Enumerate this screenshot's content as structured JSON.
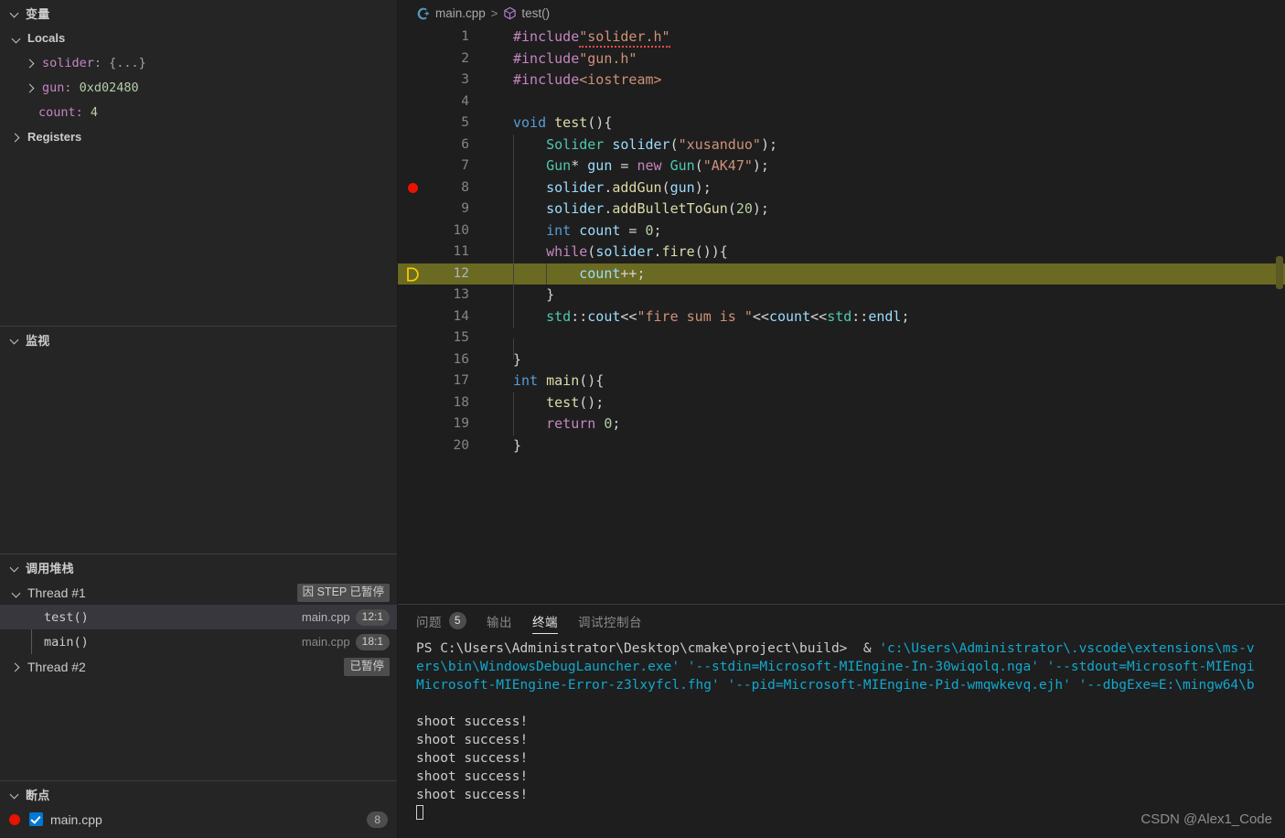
{
  "sidebar": {
    "variables": {
      "title": "变量",
      "locals_label": "Locals",
      "registers_label": "Registers",
      "locals": [
        {
          "name": "solider:",
          "value": "{...}",
          "value_kind": "object",
          "expandable": true
        },
        {
          "name": "gun:",
          "value": "0xd02480",
          "value_kind": "number",
          "expandable": true
        },
        {
          "name": "count:",
          "value": "4",
          "value_kind": "number",
          "expandable": false
        }
      ]
    },
    "watch": {
      "title": "监视",
      "items": []
    },
    "callstack": {
      "title": "调用堆栈",
      "threads": [
        {
          "name": "Thread #1",
          "status": "因 STEP 已暂停",
          "expanded": true,
          "frames": [
            {
              "func": "test()",
              "file": "main.cpp",
              "pos": "12:1",
              "selected": true
            },
            {
              "func": "main()",
              "file": "main.cpp",
              "pos": "18:1",
              "selected": false
            }
          ]
        },
        {
          "name": "Thread #2",
          "status": "已暂停",
          "expanded": false,
          "frames": []
        }
      ]
    },
    "breakpoints": {
      "title": "断点",
      "items": [
        {
          "file": "main.cpp",
          "line": "8",
          "enabled": true
        }
      ]
    }
  },
  "editor": {
    "breadcrumb": {
      "file": "main.cpp",
      "separator": ">",
      "symbol": "test()"
    },
    "lines": [
      {
        "n": "1",
        "tokens": [
          {
            "t": "#include",
            "c": "t-pre"
          },
          {
            "t": "\"solider.h\"",
            "c": "t-str squiggle"
          }
        ]
      },
      {
        "n": "2",
        "tokens": [
          {
            "t": "#include",
            "c": "t-pre"
          },
          {
            "t": "\"gun.h\"",
            "c": "t-str"
          }
        ]
      },
      {
        "n": "3",
        "tokens": [
          {
            "t": "#include",
            "c": "t-pre"
          },
          {
            "t": "<iostream>",
            "c": "t-str"
          }
        ]
      },
      {
        "n": "4",
        "tokens": []
      },
      {
        "n": "5",
        "tokens": [
          {
            "t": "void ",
            "c": "t-kw"
          },
          {
            "t": "test",
            "c": "t-fn"
          },
          {
            "t": "(){",
            "c": "t-plain"
          }
        ]
      },
      {
        "n": "6",
        "indent": 1,
        "tokens": [
          {
            "t": "    ",
            "c": "t-plain"
          },
          {
            "t": "Solider",
            "c": "t-type"
          },
          {
            "t": " solider",
            "c": "t-var"
          },
          {
            "t": "(",
            "c": "t-plain"
          },
          {
            "t": "\"xusanduo\"",
            "c": "t-str"
          },
          {
            "t": ");",
            "c": "t-plain"
          }
        ]
      },
      {
        "n": "7",
        "indent": 1,
        "tokens": [
          {
            "t": "    ",
            "c": "t-plain"
          },
          {
            "t": "Gun",
            "c": "t-type"
          },
          {
            "t": "* ",
            "c": "t-plain"
          },
          {
            "t": "gun",
            "c": "t-var"
          },
          {
            "t": " = ",
            "c": "t-plain"
          },
          {
            "t": "new",
            "c": "t-ctrl"
          },
          {
            "t": " ",
            "c": "t-plain"
          },
          {
            "t": "Gun",
            "c": "t-type"
          },
          {
            "t": "(",
            "c": "t-plain"
          },
          {
            "t": "\"AK47\"",
            "c": "t-str"
          },
          {
            "t": ");",
            "c": "t-plain"
          }
        ]
      },
      {
        "n": "8",
        "indent": 1,
        "breakpoint": true,
        "tokens": [
          {
            "t": "    ",
            "c": "t-plain"
          },
          {
            "t": "solider",
            "c": "t-var"
          },
          {
            "t": ".",
            "c": "t-plain"
          },
          {
            "t": "addGun",
            "c": "t-fn"
          },
          {
            "t": "(",
            "c": "t-plain"
          },
          {
            "t": "gun",
            "c": "t-var"
          },
          {
            "t": ");",
            "c": "t-plain"
          }
        ]
      },
      {
        "n": "9",
        "indent": 1,
        "tokens": [
          {
            "t": "    ",
            "c": "t-plain"
          },
          {
            "t": "solider",
            "c": "t-var"
          },
          {
            "t": ".",
            "c": "t-plain"
          },
          {
            "t": "addBulletToGun",
            "c": "t-fn"
          },
          {
            "t": "(",
            "c": "t-plain"
          },
          {
            "t": "20",
            "c": "t-num"
          },
          {
            "t": ");",
            "c": "t-plain"
          }
        ]
      },
      {
        "n": "10",
        "indent": 1,
        "tokens": [
          {
            "t": "    ",
            "c": "t-plain"
          },
          {
            "t": "int",
            "c": "t-kw"
          },
          {
            "t": " ",
            "c": "t-plain"
          },
          {
            "t": "count",
            "c": "t-var"
          },
          {
            "t": " = ",
            "c": "t-plain"
          },
          {
            "t": "0",
            "c": "t-num"
          },
          {
            "t": ";",
            "c": "t-plain"
          }
        ]
      },
      {
        "n": "11",
        "indent": 1,
        "tokens": [
          {
            "t": "    ",
            "c": "t-plain"
          },
          {
            "t": "while",
            "c": "t-ctrl"
          },
          {
            "t": "(",
            "c": "t-plain"
          },
          {
            "t": "solider",
            "c": "t-var"
          },
          {
            "t": ".",
            "c": "t-plain"
          },
          {
            "t": "fire",
            "c": "t-fn"
          },
          {
            "t": "()){",
            "c": "t-plain"
          }
        ]
      },
      {
        "n": "12",
        "indent": 2,
        "exec": true,
        "tokens": [
          {
            "t": "        ",
            "c": "t-plain"
          },
          {
            "t": "count",
            "c": "t-var"
          },
          {
            "t": "++;",
            "c": "t-plain"
          }
        ]
      },
      {
        "n": "13",
        "indent": 1,
        "tokens": [
          {
            "t": "    ",
            "c": "t-plain"
          },
          {
            "t": "}",
            "c": "t-plain"
          }
        ]
      },
      {
        "n": "14",
        "indent": 1,
        "tokens": [
          {
            "t": "    ",
            "c": "t-plain"
          },
          {
            "t": "std",
            "c": "t-type"
          },
          {
            "t": "::",
            "c": "t-plain"
          },
          {
            "t": "cout",
            "c": "t-var"
          },
          {
            "t": "<<",
            "c": "t-plain"
          },
          {
            "t": "\"fire sum is \"",
            "c": "t-str"
          },
          {
            "t": "<<",
            "c": "t-plain"
          },
          {
            "t": "count",
            "c": "t-var"
          },
          {
            "t": "<<",
            "c": "t-plain"
          },
          {
            "t": "std",
            "c": "t-type"
          },
          {
            "t": "::",
            "c": "t-plain"
          },
          {
            "t": "endl",
            "c": "t-var"
          },
          {
            "t": ";",
            "c": "t-plain"
          }
        ]
      },
      {
        "n": "15",
        "indent": 1,
        "tokens": []
      },
      {
        "n": "16",
        "tokens": [
          {
            "t": "}",
            "c": "t-plain"
          }
        ]
      },
      {
        "n": "17",
        "tokens": [
          {
            "t": "int",
            "c": "t-kw"
          },
          {
            "t": " ",
            "c": "t-plain"
          },
          {
            "t": "main",
            "c": "t-fn"
          },
          {
            "t": "(){",
            "c": "t-plain"
          }
        ]
      },
      {
        "n": "18",
        "indent": 1,
        "tokens": [
          {
            "t": "    ",
            "c": "t-plain"
          },
          {
            "t": "test",
            "c": "t-fn"
          },
          {
            "t": "();",
            "c": "t-plain"
          }
        ]
      },
      {
        "n": "19",
        "indent": 1,
        "tokens": [
          {
            "t": "    ",
            "c": "t-plain"
          },
          {
            "t": "return",
            "c": "t-ctrl"
          },
          {
            "t": " ",
            "c": "t-plain"
          },
          {
            "t": "0",
            "c": "t-num"
          },
          {
            "t": ";",
            "c": "t-plain"
          }
        ]
      },
      {
        "n": "20",
        "tokens": [
          {
            "t": "}",
            "c": "t-plain"
          }
        ]
      }
    ]
  },
  "panel": {
    "tabs": [
      {
        "label": "问题",
        "badge": "5",
        "active": false
      },
      {
        "label": "输出",
        "badge": null,
        "active": false
      },
      {
        "label": "终端",
        "badge": null,
        "active": true
      },
      {
        "label": "调试控制台",
        "badge": null,
        "active": false
      }
    ],
    "terminal": {
      "lines": [
        [
          {
            "t": "PS C:\\Users\\Administrator\\Desktop\\cmake\\project\\build>",
            "c": "term-plain"
          },
          {
            "t": "  & ",
            "c": "term-plain"
          },
          {
            "t": "'c:\\Users\\Administrator\\.vscode\\extensions\\ms-v",
            "c": "term-cyan"
          }
        ],
        [
          {
            "t": "ers\\bin\\WindowsDebugLauncher.exe' '--stdin=Microsoft-MIEngine-In-30wiqolq.nga' '--stdout=Microsoft-MIEngi",
            "c": "term-cyan"
          }
        ],
        [
          {
            "t": "Microsoft-MIEngine-Error-z3lxyfcl.fhg' '--pid=Microsoft-MIEngine-Pid-wmqwkevq.ejh' '--dbgExe=E:\\mingw64\\b",
            "c": "term-cyan"
          }
        ],
        [],
        [
          {
            "t": "shoot success!",
            "c": "term-plain"
          }
        ],
        [
          {
            "t": "shoot success!",
            "c": "term-plain"
          }
        ],
        [
          {
            "t": "shoot success!",
            "c": "term-plain"
          }
        ],
        [
          {
            "t": "shoot success!",
            "c": "term-plain"
          }
        ],
        [
          {
            "t": "shoot success!",
            "c": "term-plain"
          }
        ]
      ],
      "cursor": true
    }
  },
  "watermark": "CSDN @Alex1_Code",
  "colors": {
    "editor_bg": "#1e1e1e",
    "sidebar_bg": "#252526",
    "exec_line": "#6a6a22",
    "breakpoint_red": "#e51400",
    "exec_arrow": "#ffcc00",
    "terminal_cyan": "#11a8cd",
    "selection": "#37373d"
  }
}
